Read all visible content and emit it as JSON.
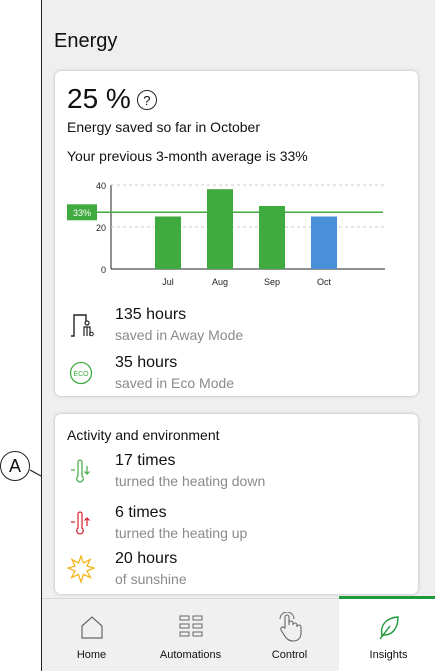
{
  "screen": {
    "title": "Energy"
  },
  "energy_card": {
    "percent": "25 %",
    "help_symbol": "?",
    "saved_text": "Energy saved so far in October",
    "average_text": "Your previous 3-month average is 33%"
  },
  "chart_data": {
    "type": "bar",
    "categories": [
      "Jul",
      "Aug",
      "Sep",
      "Oct"
    ],
    "values": [
      25,
      38,
      30,
      25
    ],
    "bar_colors": [
      "#3faa3f",
      "#3faa3f",
      "#3faa3f",
      "#4a90d9"
    ],
    "yticks": [
      0,
      20,
      40
    ],
    "ylim": [
      0,
      40
    ],
    "reference_line": {
      "value": 27,
      "label": "33%",
      "color": "#3faa3f"
    }
  },
  "stats": [
    {
      "value": "135 hours",
      "label": "saved in Away Mode",
      "icon": "away-mode-icon"
    },
    {
      "value": "35 hours",
      "label": "saved in Eco Mode",
      "icon": "eco-icon"
    }
  ],
  "activity": {
    "title": "Activity and environment",
    "items": [
      {
        "value": "17 times",
        "label": "turned the heating down",
        "icon": "thermometer-down-icon",
        "color": "#3faa3f"
      },
      {
        "value": "6 times",
        "label": "turned the heating up",
        "icon": "thermometer-up-icon",
        "color": "#d0202a"
      },
      {
        "value": "20 hours",
        "label": "of sunshine",
        "icon": "sun-icon",
        "color": "#f2b51c"
      }
    ]
  },
  "nav": [
    {
      "label": "Home",
      "icon": "home-icon",
      "active": false
    },
    {
      "label": "Automations",
      "icon": "automations-grid-icon",
      "active": false
    },
    {
      "label": "Control",
      "icon": "touch-hand-icon",
      "active": false
    },
    {
      "label": "Insights",
      "icon": "leaf-icon",
      "active": true
    }
  ],
  "colors": {
    "accent": "#1f9a3a",
    "background": "#efefef",
    "muted_text": "#8a8a8a"
  },
  "callout": {
    "label": "A"
  }
}
